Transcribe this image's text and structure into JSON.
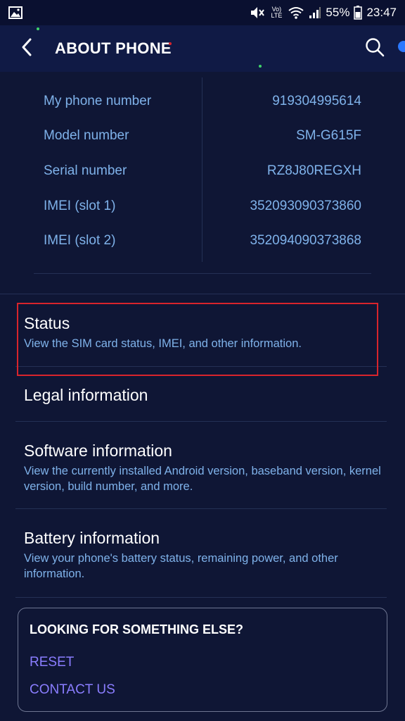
{
  "status_bar": {
    "battery": "55%",
    "time": "23:47",
    "volte": "Vo) LTE"
  },
  "app_bar": {
    "title": "ABOUT PHONE"
  },
  "info": [
    {
      "label": "My phone number",
      "value": "919304995614"
    },
    {
      "label": "Model number",
      "value": "SM-G615F"
    },
    {
      "label": "Serial number",
      "value": "RZ8J80REGXH"
    },
    {
      "label": "IMEI (slot 1)",
      "value": "352093090373860"
    },
    {
      "label": "IMEI (slot 2)",
      "value": "352094090373868"
    }
  ],
  "menu": [
    {
      "title": "Status",
      "subtitle": "View the SIM card status, IMEI, and other information."
    },
    {
      "title": "Legal information",
      "subtitle": ""
    },
    {
      "title": "Software information",
      "subtitle": "View the currently installed Android version, baseband version, kernel version, build number, and more."
    },
    {
      "title": "Battery information",
      "subtitle": "View your phone's battery status, remaining power, and other information."
    }
  ],
  "card": {
    "title": "LOOKING FOR SOMETHING ELSE?",
    "links": [
      "RESET",
      "CONTACT US"
    ]
  },
  "colors": {
    "background": "#0f1635",
    "app_bar": "#101a45",
    "accent_text": "#7fb2ea",
    "link": "#8a7dff",
    "highlight": "#d8242c"
  }
}
